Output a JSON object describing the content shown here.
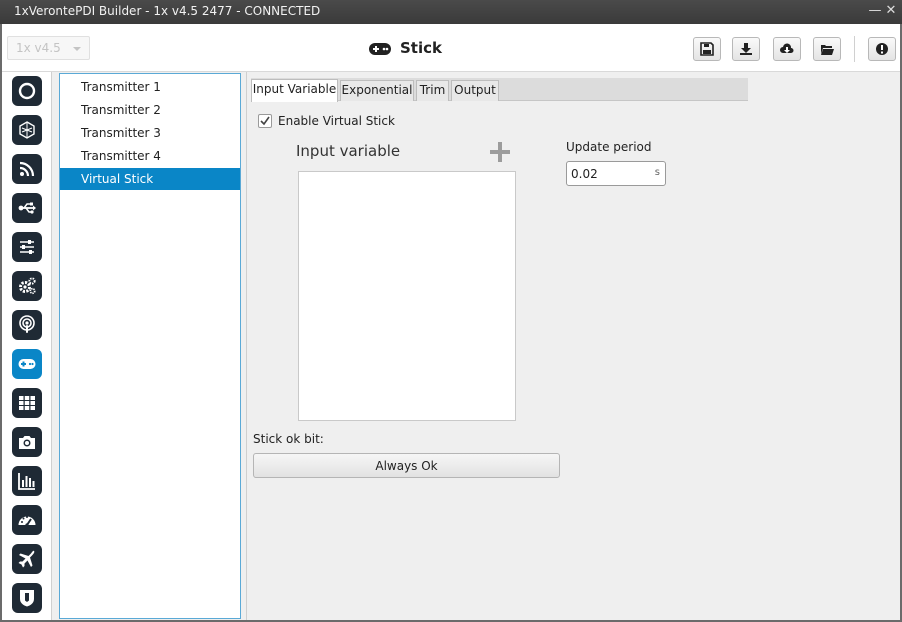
{
  "window": {
    "title": "1xVerontePDI Builder - 1x v4.5 2477 - CONNECTED"
  },
  "header": {
    "version_select": "1x v4.5",
    "page_title": "Stick",
    "buttons": [
      "save-icon",
      "download-icon",
      "cloud-download-icon",
      "folder-open-icon",
      "alert-icon"
    ]
  },
  "sidebar": {
    "icons": [
      "power-icon",
      "hexagon-icon",
      "rss-icon",
      "usb-icon",
      "sliders-icon",
      "gears-icon",
      "podcast-icon",
      "gamepad-icon",
      "grid-icon",
      "camera-icon",
      "bar-chart-icon",
      "dashboard-icon",
      "plane-icon",
      "shield-icon"
    ],
    "active": "gamepad-icon"
  },
  "list": {
    "items": [
      "Transmitter 1",
      "Transmitter 2",
      "Transmitter 3",
      "Transmitter 4",
      "Virtual Stick"
    ],
    "selected": "Virtual Stick"
  },
  "tabs": [
    "Input Variable",
    "Exponential",
    "Trim",
    "Output"
  ],
  "active_tab": "Input Variable",
  "form": {
    "enable_label": "Enable Virtual Stick",
    "enable_checked": true,
    "input_variable_label": "Input variable",
    "update_period_label": "Update period",
    "update_period_value": "0.02",
    "update_period_unit": "s",
    "stick_ok_label": "Stick ok bit:",
    "stick_ok_button": "Always Ok"
  },
  "colors": {
    "accent": "#0a86c7",
    "icon_bg": "#1f2a35",
    "titlebar": "#3f3f3f"
  }
}
